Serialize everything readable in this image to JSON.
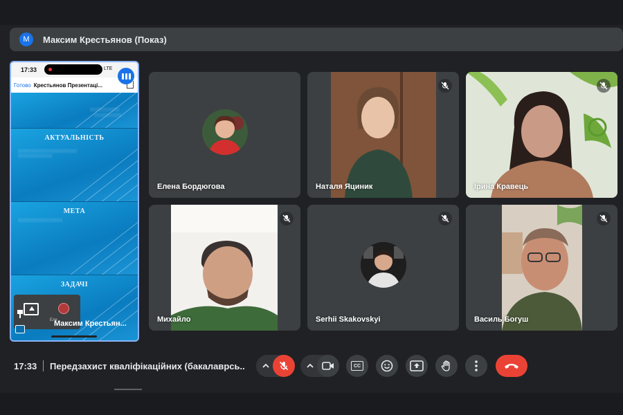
{
  "presenter_bar": {
    "avatar_letter": "M",
    "title": "Максим Крестьянов (Показ)"
  },
  "shared_screen": {
    "phone_time": "17:33",
    "carrier": "LTE",
    "app_done": "Готово",
    "doc_name": "Крестьянов Презентаці...",
    "slides": [
      {
        "heading": ""
      },
      {
        "heading": "АКТУАЛЬНІСТЬ"
      },
      {
        "heading": "МЕТА"
      },
      {
        "heading": "ЗАДАЧІ"
      }
    ],
    "mini_tile_name": "Еле",
    "presenter_name": "Максим Крестьян..."
  },
  "participants": [
    {
      "name": "Елена Бордюгова",
      "muted": false,
      "video": false
    },
    {
      "name": "Наталя Яциник",
      "muted": true,
      "video": true
    },
    {
      "name": "Ірина Кравець",
      "muted": true,
      "video": true
    },
    {
      "name": "Михайло",
      "muted": true,
      "video": true
    },
    {
      "name": "Serhii Skakovskyi",
      "muted": true,
      "video": false
    },
    {
      "name": "Василь Богуш",
      "muted": true,
      "video": true
    }
  ],
  "meeting": {
    "time": "17:33",
    "title": "Передзахист кваліфікаційних (бакалаврсь..."
  },
  "controls": {
    "mic": "mic-off-icon",
    "camera": "camera-icon",
    "captions": "CC",
    "reactions": "emoji-icon",
    "present": "present-icon",
    "hand": "raise-hand-icon",
    "more": "more-vert-icon",
    "leave": "hangup-icon"
  },
  "colors": {
    "accent": "#8ab4f8",
    "danger": "#ea4335",
    "tile": "#3c4043",
    "background": "#202124"
  }
}
